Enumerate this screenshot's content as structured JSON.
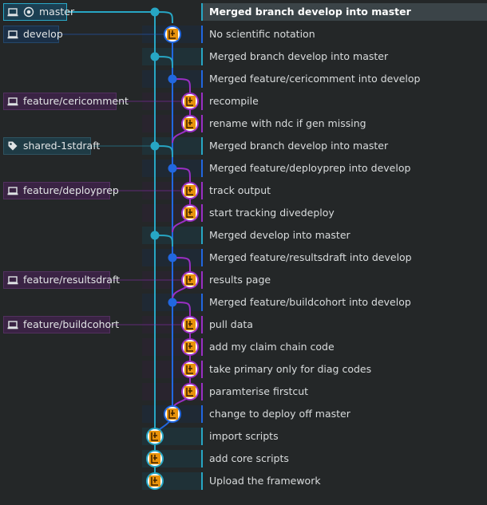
{
  "colors": {
    "background": "#242728",
    "master_lane": "#27a6c4",
    "develop_lane": "#2167e0",
    "feature_lane": "#9a2fc4",
    "selected_row": "#3b4448",
    "avatar_orange": "#e8930c"
  },
  "refs": {
    "master": {
      "label": "master",
      "icon": "laptop-icon",
      "icon2": "target-icon"
    },
    "develop": {
      "label": "develop",
      "icon": "laptop-icon"
    },
    "feature_cericomment": {
      "label": "feature/cericomment",
      "icon": "laptop-icon"
    },
    "shared_tag": {
      "label": "shared-1stdraft",
      "icon": "tag-icon"
    },
    "feature_deployprep": {
      "label": "feature/deployprep",
      "icon": "laptop-icon"
    },
    "feature_resultsdraft": {
      "label": "feature/resultsdraft",
      "icon": "laptop-icon"
    },
    "feature_buildcohort": {
      "label": "feature/buildcohort",
      "icon": "laptop-icon"
    }
  },
  "commits": [
    {
      "message": "Merged branch develop into master",
      "lane": "master",
      "kind": "merge",
      "selected": true
    },
    {
      "message": "No scientific notation",
      "lane": "develop",
      "kind": "avatar"
    },
    {
      "message": "Merged branch develop into master",
      "lane": "master",
      "kind": "merge"
    },
    {
      "message": "Merged feature/cericomment into develop",
      "lane": "develop",
      "kind": "merge"
    },
    {
      "message": "recompile",
      "lane": "feature",
      "kind": "avatar"
    },
    {
      "message": "rename with ndc if gen missing",
      "lane": "feature",
      "kind": "avatar"
    },
    {
      "message": "Merged branch develop into master",
      "lane": "master",
      "kind": "merge"
    },
    {
      "message": "Merged feature/deployprep into develop",
      "lane": "develop",
      "kind": "merge"
    },
    {
      "message": "track output",
      "lane": "feature",
      "kind": "avatar"
    },
    {
      "message": "start tracking divedeploy",
      "lane": "feature",
      "kind": "avatar"
    },
    {
      "message": "Merged develop into master",
      "lane": "master",
      "kind": "merge"
    },
    {
      "message": "Merged feature/resultsdraft into develop",
      "lane": "develop",
      "kind": "merge"
    },
    {
      "message": "results page",
      "lane": "feature",
      "kind": "avatar"
    },
    {
      "message": "Merged feature/buildcohort into develop",
      "lane": "develop",
      "kind": "merge"
    },
    {
      "message": "pull data",
      "lane": "feature",
      "kind": "avatar"
    },
    {
      "message": "add my claim chain code",
      "lane": "feature",
      "kind": "avatar"
    },
    {
      "message": "take primary only for diag codes",
      "lane": "feature",
      "kind": "avatar"
    },
    {
      "message": "paramterise firstcut",
      "lane": "feature",
      "kind": "avatar"
    },
    {
      "message": "change to deploy off master",
      "lane": "develop",
      "kind": "avatar"
    },
    {
      "message": "import scripts",
      "lane": "master",
      "kind": "avatar"
    },
    {
      "message": "add core scripts",
      "lane": "master",
      "kind": "avatar"
    },
    {
      "message": "Upload the framework",
      "lane": "master",
      "kind": "avatar"
    }
  ]
}
